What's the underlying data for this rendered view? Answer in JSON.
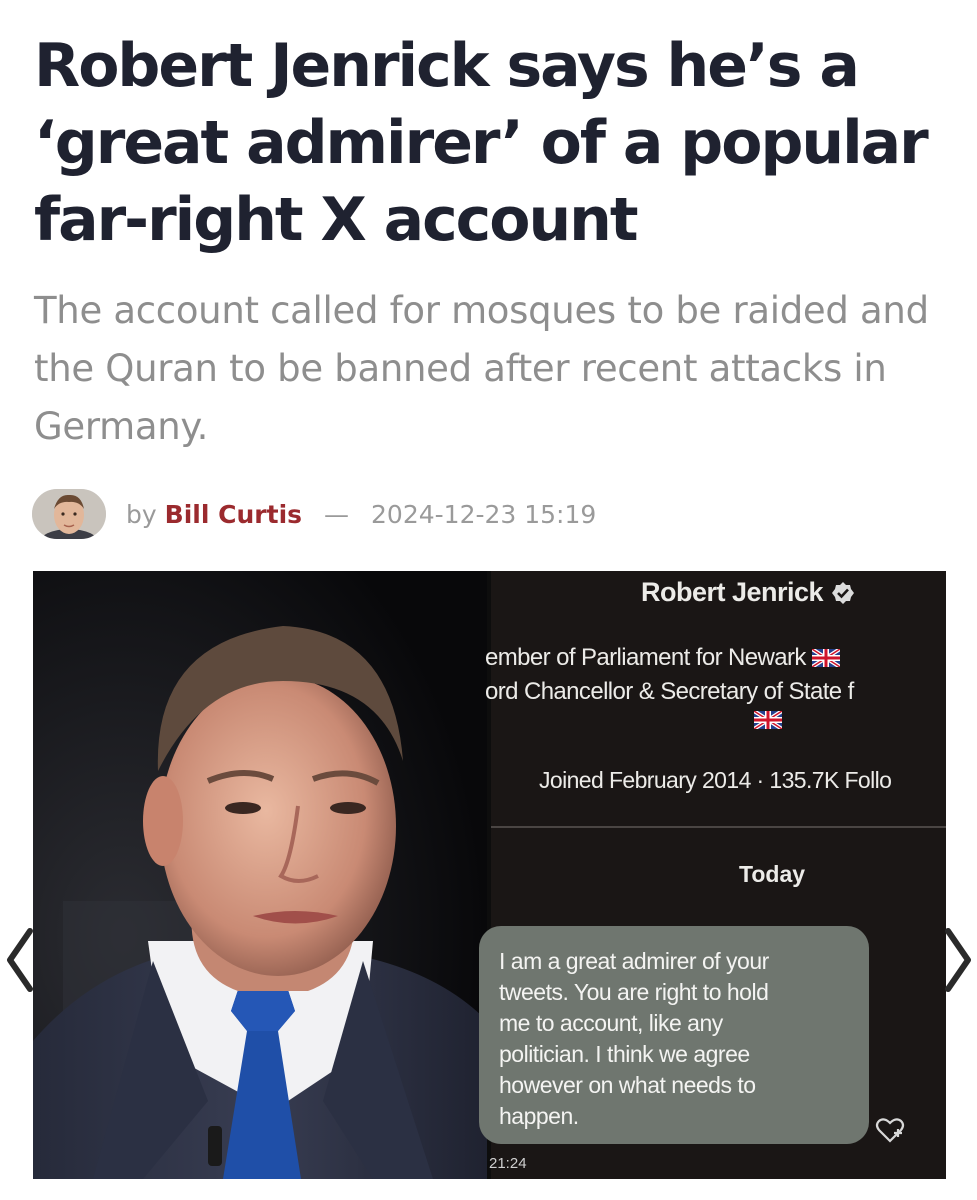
{
  "article": {
    "title": "Robert Jenrick says he’s a ‘great admirer’ of a popular far-right X account",
    "subtitle": "The account called for mosques to be raided and the Quran to be banned after recent attacks in Germany.",
    "byline": {
      "prefix": "by",
      "author": "Bill Curtis",
      "separator": "—",
      "datetime": "2024-12-23 15:19"
    }
  },
  "gallery": {
    "screenshot": {
      "profile_name": "Robert Jenrick",
      "bio_line_1": "ember of Parliament for Newark",
      "bio_line_2": "ord Chancellor & Secretary of State f",
      "joined": "Joined February 2014 · 135.7K Follo",
      "day_label": "Today",
      "message_lines": [
        "I am a great admirer of your",
        "tweets. You are right to hold",
        "me to account, like any",
        "politician. I think we agree",
        "however on what needs to",
        "happen."
      ],
      "message_time": "21:24"
    },
    "icons": {
      "prev": "chevron-left-icon",
      "next": "chevron-right-icon",
      "verified": "verified-badge-icon",
      "flag": "uk-flag-icon",
      "react": "heart-plus-icon"
    }
  },
  "colors": {
    "headline": "#1f2230",
    "subtitle": "#8e8e8e",
    "author_link": "#9b2a2e",
    "message_bubble": "#6f766f"
  }
}
